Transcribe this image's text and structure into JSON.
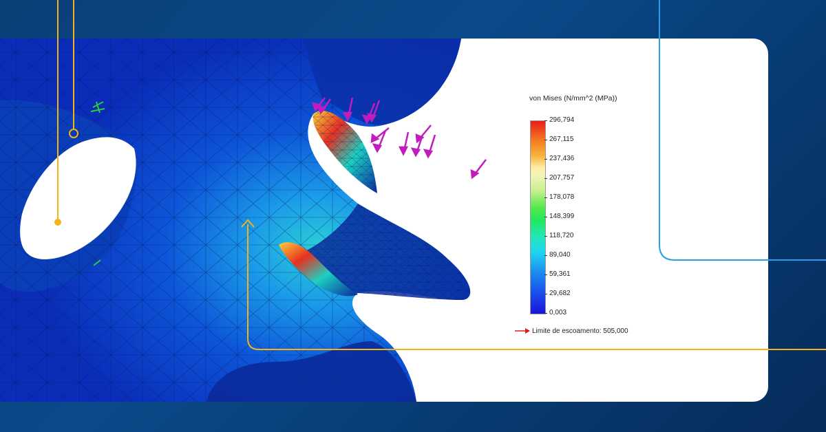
{
  "legend": {
    "title": "von Mises (N/mm^2 (MPa))",
    "ticks": [
      "296,794",
      "267,115",
      "237,436",
      "207,757",
      "178,078",
      "148,399",
      "118,720",
      "89,040",
      "59,361",
      "29,682",
      "0,003"
    ],
    "yield_label": "Limite de escoamento: 505,000",
    "yield_color": "#e01b1b"
  },
  "colors": {
    "background": "#0a4a8a",
    "accent_yellow": "#f5b21a",
    "accent_cyan": "#2a9fe6",
    "force_arrows": "#c21bbf"
  }
}
